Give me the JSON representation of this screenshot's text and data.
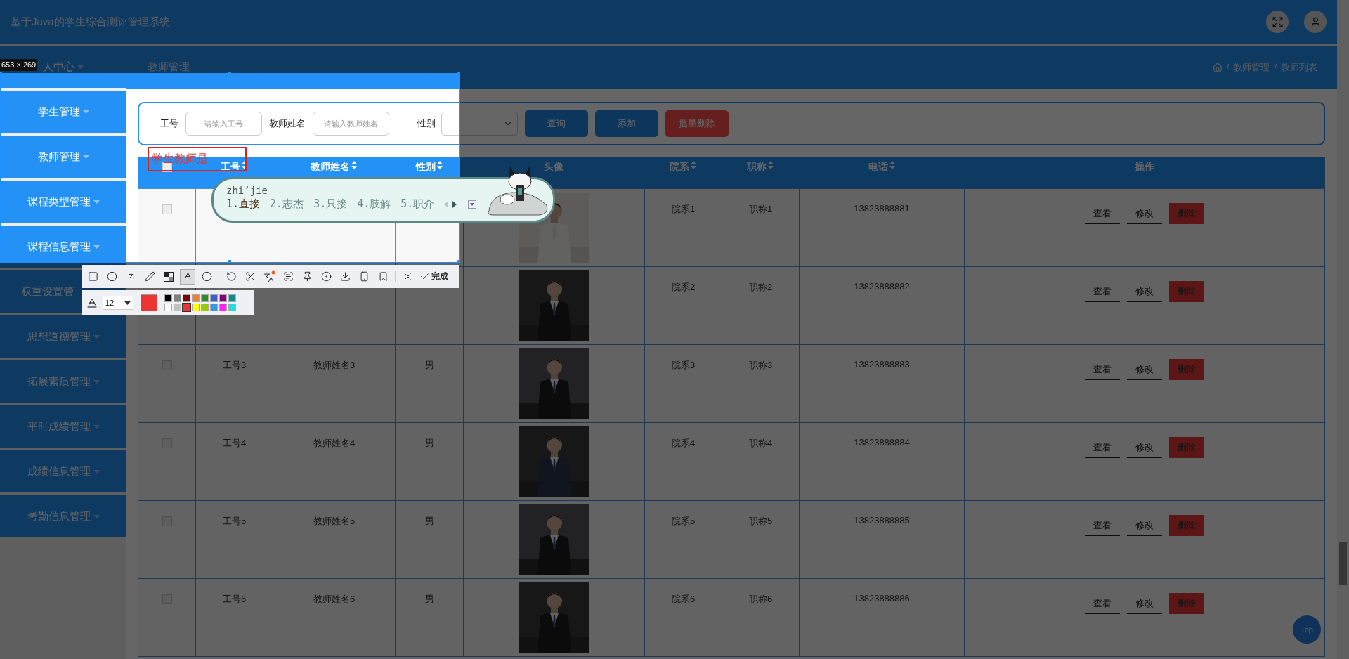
{
  "header": {
    "title": "基于Java的学生综合测评管理系统"
  },
  "sidebar": {
    "items": [
      {
        "label": "人中心",
        "caret": true
      },
      {
        "label": "学生管理",
        "caret": true
      },
      {
        "label": "教师管理",
        "caret": true
      },
      {
        "label": "课程类型管理",
        "caret": true
      },
      {
        "label": "课程信息管理",
        "caret": true
      },
      {
        "label": "权重设置管",
        "caret": false
      },
      {
        "label": "思想道德管理",
        "caret": true
      },
      {
        "label": "拓展素质管理",
        "caret": true
      },
      {
        "label": "平时成绩管理",
        "caret": true
      },
      {
        "label": "成绩信息管理",
        "caret": true
      },
      {
        "label": "考勤信息管理",
        "caret": true
      }
    ]
  },
  "page_bar": {
    "title": "教师管理",
    "separator": "/",
    "breadcrumb": [
      "教师管理",
      "教师列表"
    ]
  },
  "search": {
    "fields": [
      {
        "kind": "input",
        "label": "工号",
        "placeholder": "请输入工号"
      },
      {
        "kind": "input",
        "label": "教师姓名",
        "placeholder": "请输入教师姓名"
      },
      {
        "kind": "select",
        "label": "性别"
      }
    ],
    "buttons": [
      {
        "kind": "primary",
        "label": "查询"
      },
      {
        "kind": "primary",
        "label": "添加"
      },
      {
        "kind": "danger",
        "label": "批量删除"
      }
    ]
  },
  "table": {
    "select_all": {
      "checked": false
    },
    "columns": [
      {
        "label": "工号",
        "sortable": true
      },
      {
        "label": "教师姓名",
        "sortable": true
      },
      {
        "label": "性别",
        "sortable": true
      },
      {
        "label": "头像",
        "sortable": false
      },
      {
        "label": "院系",
        "sortable": true
      },
      {
        "label": "职称",
        "sortable": true
      },
      {
        "label": "电话",
        "sortable": true
      },
      {
        "label": "操作",
        "sortable": false
      }
    ],
    "rows": [
      {
        "checked": false,
        "department": "院系1",
        "title": "职称1",
        "phone": "13823888881",
        "actions": [
          {
            "kind": "plain",
            "label": "查看"
          },
          {
            "kind": "plain",
            "label": "修改"
          },
          {
            "kind": "danger",
            "label": "删除"
          }
        ]
      },
      {
        "department": "院系2",
        "title": "职称2",
        "phone": "13823888882",
        "actions": [
          {
            "kind": "plain",
            "label": "查看"
          },
          {
            "kind": "plain",
            "label": "修改"
          },
          {
            "kind": "danger",
            "label": "删除"
          }
        ]
      },
      {
        "checked": false,
        "id": "工号3",
        "name": "教师姓名3",
        "gender": "男",
        "department": "院系3",
        "title": "职称3",
        "phone": "13823888883",
        "actions": [
          {
            "kind": "plain",
            "label": "查看"
          },
          {
            "kind": "plain",
            "label": "修改"
          },
          {
            "kind": "danger",
            "label": "删除"
          }
        ]
      },
      {
        "checked": false,
        "id": "工号4",
        "name": "教师姓名4",
        "gender": "男",
        "department": "院系4",
        "title": "职称4",
        "phone": "13823888884",
        "actions": [
          {
            "kind": "plain",
            "label": "查看"
          },
          {
            "kind": "plain",
            "label": "修改"
          },
          {
            "kind": "danger",
            "label": "删除"
          }
        ]
      },
      {
        "checked": false,
        "id": "工号5",
        "name": "教师姓名5",
        "gender": "男",
        "department": "院系5",
        "title": "职称5",
        "phone": "13823888885",
        "actions": [
          {
            "kind": "plain",
            "label": "查看"
          },
          {
            "kind": "plain",
            "label": "修改"
          },
          {
            "kind": "danger",
            "label": "删除"
          }
        ]
      },
      {
        "checked": false,
        "id": "工号6",
        "name": "教师姓名6",
        "gender": "男",
        "department": "院系6",
        "title": "职称6",
        "phone": "13823888886",
        "actions": [
          {
            "kind": "plain",
            "label": "查看"
          },
          {
            "kind": "plain",
            "label": "修改"
          },
          {
            "kind": "danger",
            "label": "删除"
          }
        ]
      }
    ]
  },
  "back_to_top": {
    "label": "Top"
  },
  "screenshot_tool": {
    "size_label": "653 × 269",
    "annotation": {
      "text": "学生教师是"
    },
    "toolbar": {
      "groups": [
        {
          "tools": [
            {
              "kind": "rect",
              "selected": false
            },
            {
              "kind": "ellipse",
              "selected": false
            },
            {
              "kind": "arrow",
              "selected": false
            },
            {
              "kind": "pen",
              "selected": false
            },
            {
              "kind": "mosaic",
              "selected": false
            },
            {
              "kind": "text",
              "selected": true
            },
            {
              "kind": "number",
              "selected": false
            }
          ]
        },
        {
          "tools": [
            {
              "kind": "undo",
              "selected": false
            },
            {
              "kind": "cut",
              "selected": false
            },
            {
              "kind": "translate",
              "selected": false
            },
            {
              "kind": "scan",
              "selected": false
            },
            {
              "kind": "pin",
              "selected": false
            },
            {
              "kind": "record",
              "selected": false
            },
            {
              "kind": "download",
              "selected": false
            },
            {
              "kind": "phone",
              "selected": false
            },
            {
              "kind": "bookmark",
              "selected": false
            }
          ]
        },
        {
          "tools": [
            {
              "kind": "close",
              "selected": false
            }
          ]
        }
      ],
      "done_label": "完成"
    },
    "text_options": {
      "font_size": "12",
      "palette": [
        {
          "color": "#000000",
          "selected": false
        },
        {
          "color": "#808080",
          "selected": false
        },
        {
          "color": "#800000",
          "selected": false
        },
        {
          "color": "#f08030",
          "selected": false
        },
        {
          "color": "#2e8b2e",
          "selected": false
        },
        {
          "color": "#3b5bdb",
          "selected": false
        },
        {
          "color": "#800080",
          "selected": false
        },
        {
          "color": "#009090",
          "selected": false
        },
        {
          "color": "#ffffff",
          "selected": false
        },
        {
          "color": "#c0c0c0",
          "selected": false
        },
        {
          "color": "#ee3333",
          "selected": true
        },
        {
          "color": "#ffff00",
          "selected": false
        },
        {
          "color": "#99cc00",
          "selected": false
        },
        {
          "color": "#3399ee",
          "selected": false
        },
        {
          "color": "#ff22ff",
          "selected": false
        },
        {
          "color": "#22dddd",
          "selected": false
        }
      ]
    }
  },
  "ime": {
    "pinyin": "zhi’jie",
    "candidates": [
      {
        "text": "1.直接",
        "selected": true
      },
      {
        "text": "2.志杰",
        "selected": false
      },
      {
        "text": "3.只接",
        "selected": false
      },
      {
        "text": "4.肢解",
        "selected": false
      },
      {
        "text": "5.职介",
        "selected": false
      }
    ]
  }
}
